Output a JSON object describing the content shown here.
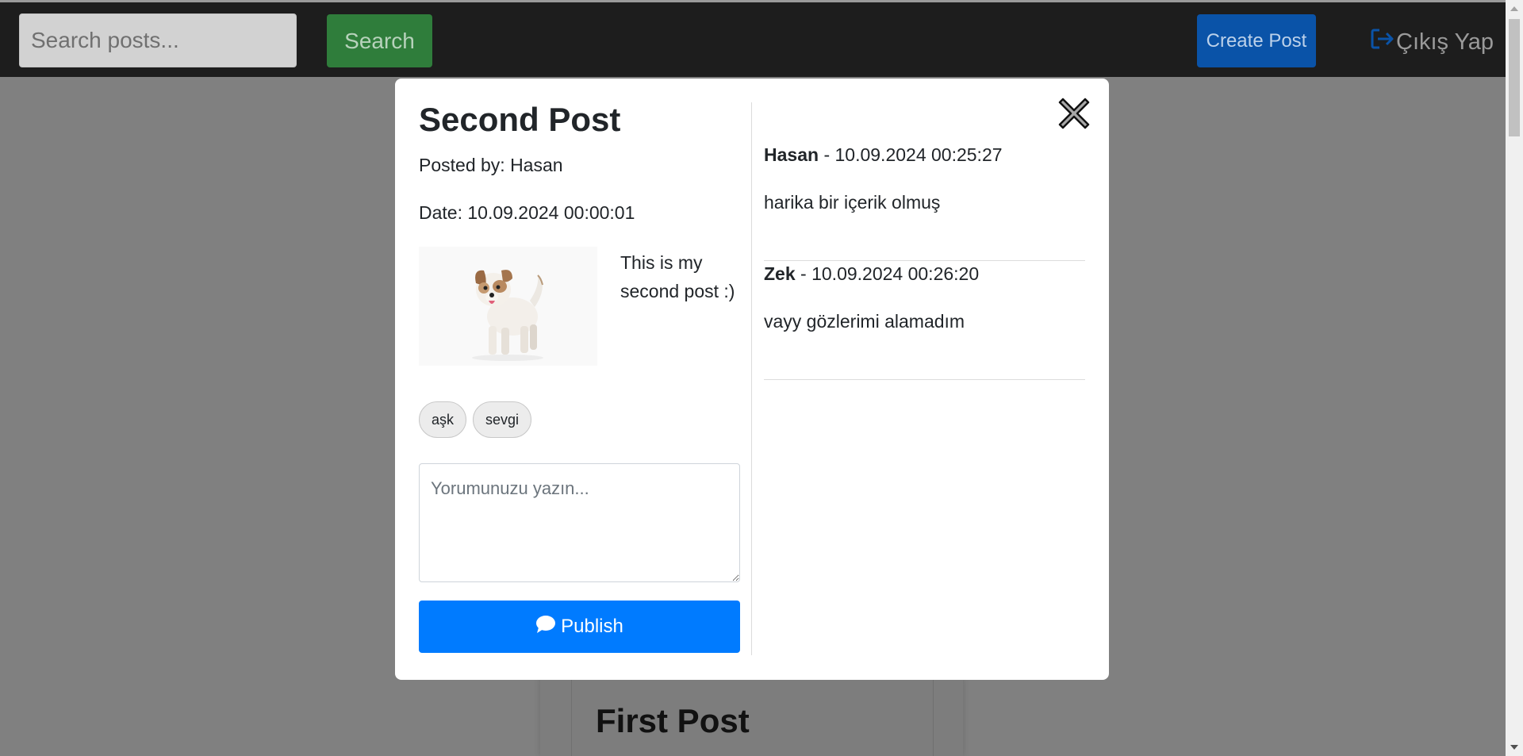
{
  "navbar": {
    "search_placeholder": "Search posts...",
    "search_label": "Search",
    "create_label": "Create Post",
    "logout_label": "Çıkış Yap"
  },
  "background_post": {
    "title": "First Post"
  },
  "modal": {
    "title": "Second Post",
    "posted_by": "Posted by: Hasan",
    "date": "Date: 10.09.2024 00:00:01",
    "content": "This is my second post :)",
    "tags": [
      "aşk",
      "sevgi"
    ],
    "comment_placeholder": "Yorumunuzu yazın...",
    "publish_label": "Publish",
    "comments": [
      {
        "author": "Hasan",
        "timestamp": "10.09.2024 00:25:27",
        "text": "harika bir içerik olmuş"
      },
      {
        "author": "Zek",
        "timestamp": "10.09.2024 00:26:20",
        "text": "vayy gözlerimi alamadım"
      }
    ]
  },
  "icons": {
    "close": "close-icon",
    "logout": "logout-icon",
    "publish": "comment-icon"
  },
  "colors": {
    "primary": "#007bff",
    "success": "#28a745",
    "navbar": "#212121"
  }
}
